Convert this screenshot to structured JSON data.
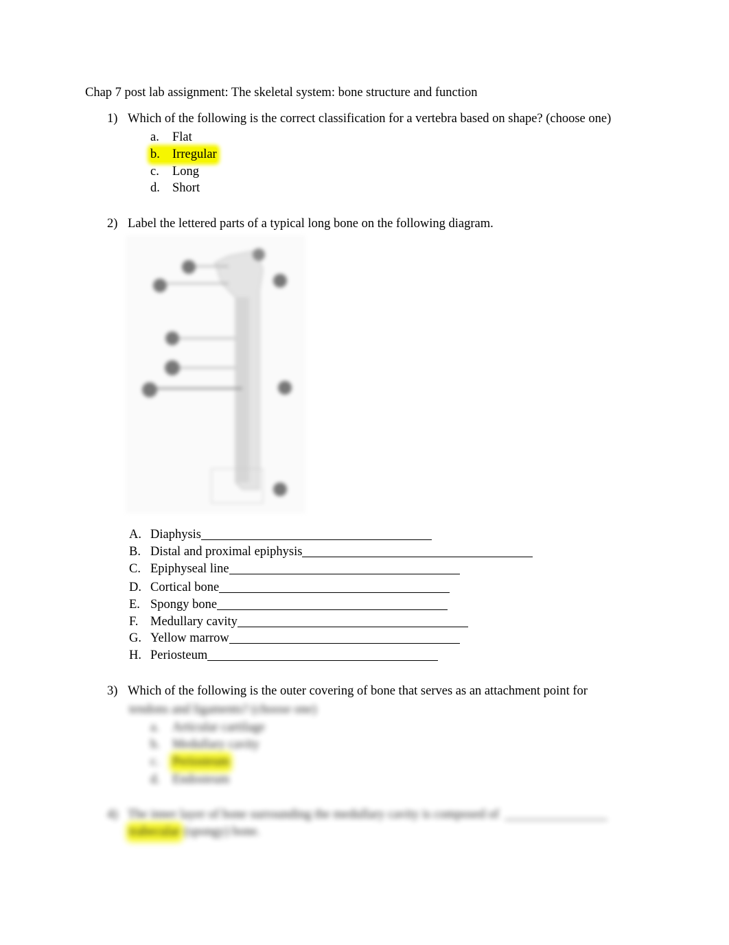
{
  "document": {
    "title": "Chap 7 post lab assignment: The skeletal system: bone structure and function",
    "questions": [
      {
        "number": "1)",
        "text": "Which of the following is the correct classification for a vertebra based on shape? (choose one)",
        "options": [
          {
            "letter": "a.",
            "text": "Flat",
            "highlighted": false
          },
          {
            "letter": "b.",
            "text": "Irregular",
            "highlighted": true
          },
          {
            "letter": "c.",
            "text": "Long",
            "highlighted": false
          },
          {
            "letter": "d.",
            "text": "Short",
            "highlighted": false
          }
        ]
      },
      {
        "number": "2)",
        "text": "Label the lettered parts of a typical long bone on the following diagram.",
        "diagram": "long-bone-diagram (blurred)",
        "labels": [
          {
            "letter": "A.",
            "text": "Diaphysis"
          },
          {
            "letter": "B.",
            "text": "Distal and proximal epiphysis"
          },
          {
            "letter": "C.",
            "text": "Epiphyseal line"
          },
          {
            "letter": "D.",
            "text": "Cortical bone"
          },
          {
            "letter": "E.",
            "text": "Spongy bone"
          },
          {
            "letter": "F.",
            "text": "Medullary cavity"
          },
          {
            "letter": "G.",
            "text": "Yellow marrow"
          },
          {
            "letter": "H.",
            "text": "Periosteum"
          }
        ]
      },
      {
        "number": "3)",
        "text": "Which of the following is the outer covering of bone that serves as an attachment point for",
        "blurred_continuation": "tendons and ligaments? (choose one)",
        "blurred_options": [
          {
            "letter": "a.",
            "text": "Articular cartilage"
          },
          {
            "letter": "b.",
            "text": "Medullary cavity"
          },
          {
            "letter": "c.",
            "text": "Periosteum",
            "highlighted": true
          },
          {
            "letter": "d.",
            "text": "Endosteum"
          }
        ]
      },
      {
        "number": "4)",
        "blurred_text": "The inner layer of bone surrounding the medullary cavity is composed of",
        "blurred_answer": "trabecular",
        "blurred_tail": "(spongy) bone."
      }
    ]
  },
  "colors": {
    "highlight": "#f6f600"
  }
}
